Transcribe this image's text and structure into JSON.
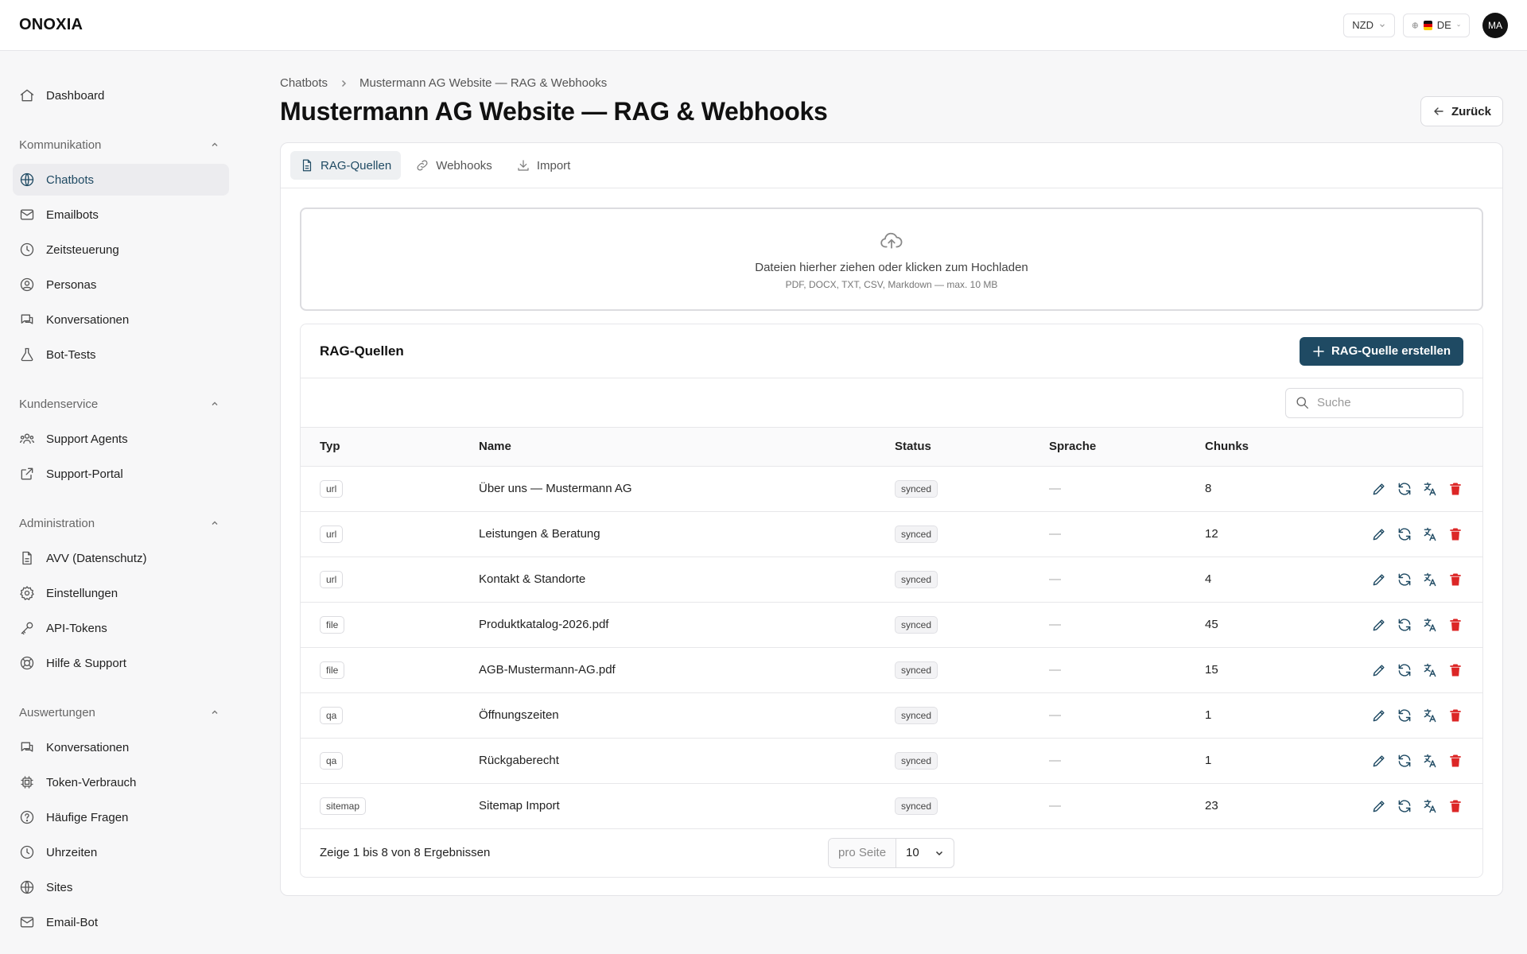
{
  "app": {
    "logo": "ONOXIA"
  },
  "topbar": {
    "currency": "NZD",
    "language": "DE",
    "avatar_initials": "MA"
  },
  "sidebar": {
    "top_items": [
      {
        "label": "Dashboard",
        "icon": "home-icon"
      }
    ],
    "groups": [
      {
        "label": "Kommunikation",
        "items": [
          {
            "label": "Chatbots",
            "icon": "globe-icon",
            "active": true
          },
          {
            "label": "Emailbots",
            "icon": "mail-icon"
          },
          {
            "label": "Zeitsteuerung",
            "icon": "clock-icon"
          },
          {
            "label": "Personas",
            "icon": "user-circle-icon"
          },
          {
            "label": "Konversationen",
            "icon": "chat-icon"
          },
          {
            "label": "Bot-Tests",
            "icon": "flask-icon"
          }
        ]
      },
      {
        "label": "Kundenservice",
        "items": [
          {
            "label": "Support Agents",
            "icon": "users-icon"
          },
          {
            "label": "Support-Portal",
            "icon": "external-link-icon"
          }
        ]
      },
      {
        "label": "Administration",
        "items": [
          {
            "label": "AVV (Datenschutz)",
            "icon": "document-icon"
          },
          {
            "label": "Einstellungen",
            "icon": "gear-icon"
          },
          {
            "label": "API-Tokens",
            "icon": "key-icon"
          },
          {
            "label": "Hilfe & Support",
            "icon": "lifebuoy-icon"
          }
        ]
      },
      {
        "label": "Auswertungen",
        "items": [
          {
            "label": "Konversationen",
            "icon": "chat-icon"
          },
          {
            "label": "Token-Verbrauch",
            "icon": "chip-icon"
          },
          {
            "label": "Häufige Fragen",
            "icon": "question-icon"
          },
          {
            "label": "Uhrzeiten",
            "icon": "clock-icon"
          },
          {
            "label": "Sites",
            "icon": "globe-icon"
          },
          {
            "label": "Email-Bot",
            "icon": "mail-icon"
          }
        ]
      }
    ]
  },
  "breadcrumb": {
    "parent": "Chatbots",
    "current": "Mustermann AG Website — RAG & Webhooks"
  },
  "page": {
    "title": "Mustermann AG Website — RAG & Webhooks",
    "back_label": "Zurück"
  },
  "tabs": [
    {
      "label": "RAG-Quellen",
      "icon": "document-icon",
      "active": true
    },
    {
      "label": "Webhooks",
      "icon": "link-icon"
    },
    {
      "label": "Import",
      "icon": "download-icon"
    }
  ],
  "dropzone": {
    "title": "Dateien hierher ziehen oder klicken zum Hochladen",
    "subtitle": "PDF, DOCX, TXT, CSV, Markdown — max. 10 MB"
  },
  "sources": {
    "title": "RAG-Quellen",
    "create_label": "RAG-Quelle erstellen",
    "search_placeholder": "Suche",
    "columns": [
      "Typ",
      "Name",
      "Status",
      "Sprache",
      "Chunks"
    ],
    "rows": [
      {
        "type": "url",
        "name": "Über uns — Mustermann AG",
        "status": "synced",
        "language": "—",
        "chunks": "8"
      },
      {
        "type": "url",
        "name": "Leistungen & Beratung",
        "status": "synced",
        "language": "—",
        "chunks": "12"
      },
      {
        "type": "url",
        "name": "Kontakt & Standorte",
        "status": "synced",
        "language": "—",
        "chunks": "4"
      },
      {
        "type": "file",
        "name": "Produktkatalog-2026.pdf",
        "status": "synced",
        "language": "—",
        "chunks": "45"
      },
      {
        "type": "file",
        "name": "AGB-Mustermann-AG.pdf",
        "status": "synced",
        "language": "—",
        "chunks": "15"
      },
      {
        "type": "qa",
        "name": "Öffnungszeiten",
        "status": "synced",
        "language": "—",
        "chunks": "1"
      },
      {
        "type": "qa",
        "name": "Rückgaberecht",
        "status": "synced",
        "language": "—",
        "chunks": "1"
      },
      {
        "type": "sitemap",
        "name": "Sitemap Import",
        "status": "synced",
        "language": "—",
        "chunks": "23"
      }
    ],
    "footer_text": "Zeige 1 bis 8 von 8 Ergebnissen",
    "per_page_label": "pro Seite",
    "per_page_value": "10"
  },
  "colors": {
    "accent": "#1f4a63",
    "danger": "#dc2626"
  }
}
